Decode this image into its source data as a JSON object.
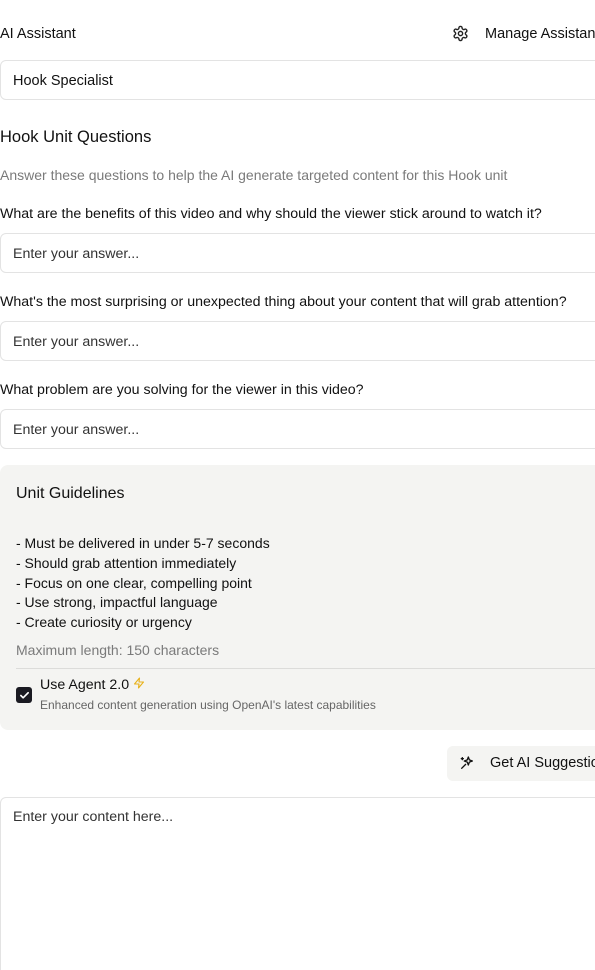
{
  "header": {
    "title": "AI Assistant",
    "manage_label": "Manage Assistants"
  },
  "assistant_select": {
    "value": "Hook Specialist"
  },
  "questions_section": {
    "title": "Hook Unit Questions",
    "description": "Answer these questions to help the AI generate targeted content for this Hook unit",
    "questions": [
      {
        "label": "What are the benefits of this video and why should the viewer stick around to watch it?",
        "placeholder": "Enter your answer..."
      },
      {
        "label": "What's the most surprising or unexpected thing about your content that will grab attention?",
        "placeholder": "Enter your answer..."
      },
      {
        "label": "What problem are you solving for the viewer in this video?",
        "placeholder": "Enter your answer..."
      }
    ]
  },
  "guidelines": {
    "title": "Unit Guidelines",
    "lines": [
      "- Must be delivered in under 5-7 seconds",
      "- Should grab attention immediately",
      "- Focus on one clear, compelling point",
      "- Use strong, impactful language",
      "- Create curiosity or urgency"
    ],
    "max_length": "Maximum length: 150 characters",
    "agent": {
      "checked": true,
      "title": "Use Agent 2.0",
      "description": "Enhanced content generation using OpenAI's latest capabilities",
      "accent_color": "#e8b21c"
    }
  },
  "suggest_button": {
    "label": "Get AI Suggestions",
    "icon": "sparkles-icon"
  },
  "content": {
    "placeholder": "Enter your content here..."
  }
}
